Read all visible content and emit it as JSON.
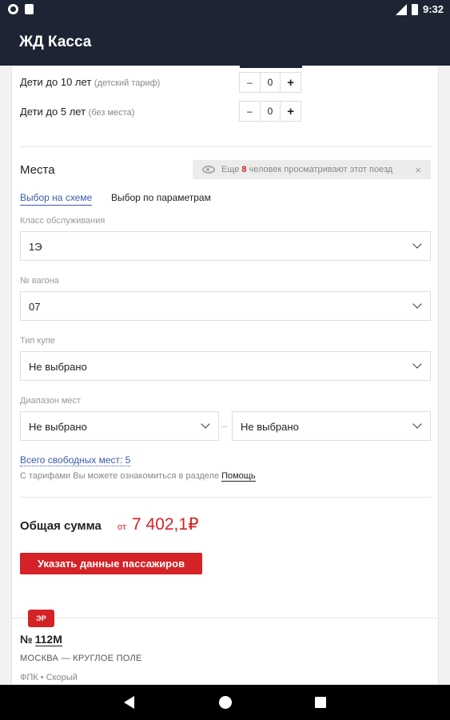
{
  "status_bar": {
    "time": "9:32",
    "network": "LTE"
  },
  "app_bar": {
    "title": "ЖД Касса"
  },
  "passengers": [
    {
      "label": "Дети до 10 лет",
      "note": "(детский тариф)",
      "count": "0",
      "minus": "–",
      "plus": "+"
    },
    {
      "label": "Дети до 5 лет",
      "note": "(без места)",
      "count": "0",
      "minus": "–",
      "plus": "+"
    }
  ],
  "places": {
    "title": "Места",
    "viewers": {
      "prefix": "Еще",
      "count": "8",
      "suffix": "человек просматривают этот поезд",
      "close": "×"
    },
    "tabs": {
      "schema": "Выбор на схеме",
      "params": "Выбор по параметрам"
    },
    "service_class": {
      "label": "Класс обслуживания",
      "value": "1Э"
    },
    "car_number": {
      "label": "№ вагона",
      "value": "07"
    },
    "compartment_type": {
      "label": "Тип купе",
      "value": "Не выбрано"
    },
    "seat_range": {
      "label": "Диапазон мест",
      "from": "Не выбрано",
      "to": "Не выбрано",
      "separator": "–"
    },
    "free_seats": "Всего свободных мест: 5",
    "tariff_note": "С тарифами Вы можете ознакомиться в разделе",
    "help_link": "Помощь"
  },
  "total": {
    "label": "Общая сумма",
    "from": "от",
    "value": "7 402,1₽"
  },
  "submit_button": "Указать данные пассажиров",
  "next_train": {
    "badge": "ЭР",
    "number_prefix": "№",
    "number": "112М",
    "route": "МОСКВА — КРУГЛОЕ ПОЛЕ",
    "carrier": "ФПК • Скорый"
  }
}
